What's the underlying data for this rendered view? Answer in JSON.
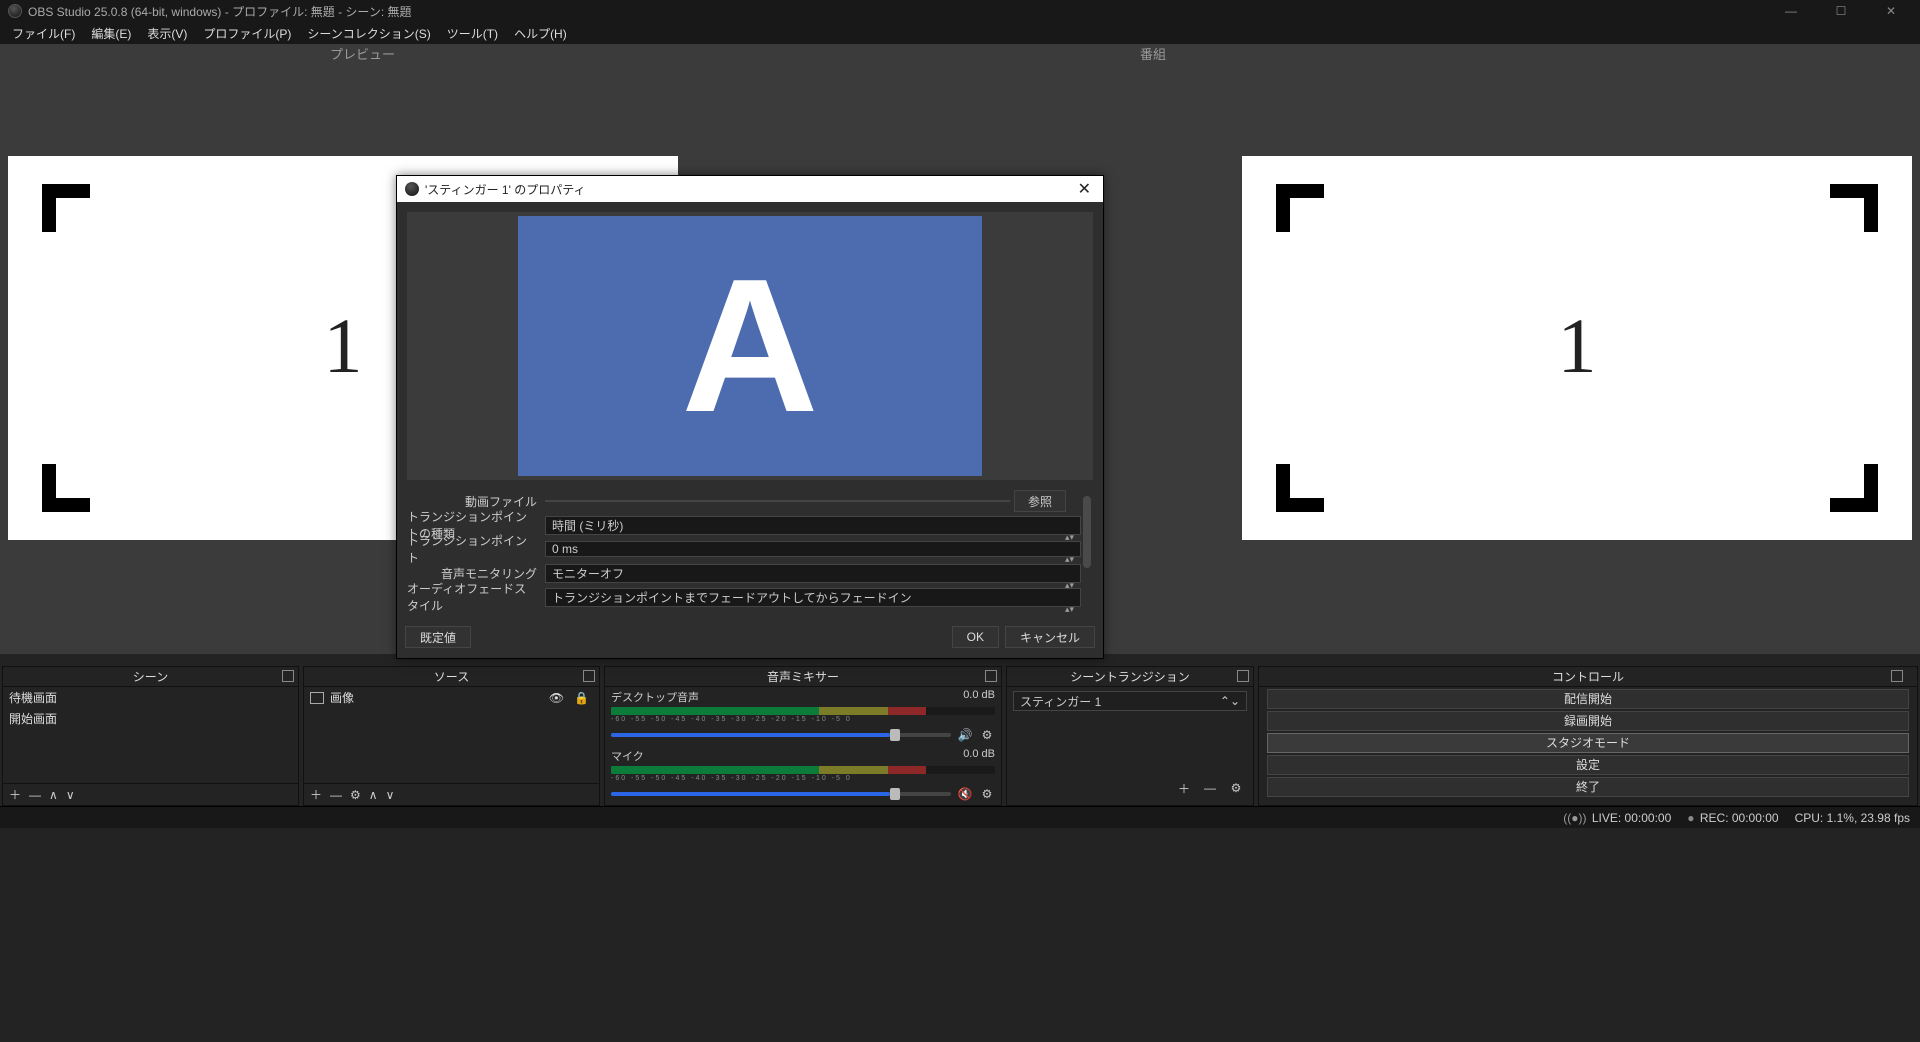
{
  "titlebar": {
    "text": "OBS Studio 25.0.8 (64-bit, windows) - プロファイル: 無題 - シーン: 無題"
  },
  "menubar": {
    "items": [
      "ファイル(F)",
      "編集(E)",
      "表示(V)",
      "プロファイル(P)",
      "シーンコレクション(S)",
      "ツール(T)",
      "ヘルプ(H)"
    ]
  },
  "labels": {
    "preview": "プレビュー",
    "program": "番組"
  },
  "canvas": {
    "number": "1"
  },
  "docks": {
    "scenes": {
      "title": "シーン",
      "items": [
        "待機画面",
        "開始画面"
      ]
    },
    "sources": {
      "title": "ソース",
      "items": [
        {
          "label": "画像"
        }
      ]
    },
    "mixer": {
      "title": "音声ミキサー",
      "channels": [
        {
          "name": "デスクトップ音声",
          "level": "0.0 dB",
          "muted": false
        },
        {
          "name": "マイク",
          "level": "0.0 dB",
          "muted": true
        }
      ],
      "ticks": "-60  -55  -50  -45  -40  -35  -30  -25  -20  -15  -10  -5  0"
    },
    "transitions": {
      "title": "シーントランジション",
      "selected": "スティンガー 1"
    },
    "controls": {
      "title": "コントロール",
      "buttons": [
        "配信開始",
        "録画開始",
        "スタジオモード",
        "設定",
        "終了"
      ],
      "active_index": 2
    }
  },
  "statusbar": {
    "live_label": "LIVE:",
    "live_time": "00:00:00",
    "rec_label": "REC:",
    "rec_time": "00:00:00",
    "cpu": "CPU: 1.1%, 23.98 fps"
  },
  "dialog": {
    "title": "'スティンガー 1' のプロパティ",
    "preview_letter": "A",
    "fields": {
      "video_file_label": "動画ファイル",
      "video_file_value": "",
      "browse": "参照",
      "tp_type_label": "トランジションポイントの種類",
      "tp_type_value": "時間 (ミリ秒)",
      "tp_label": "トランジションポイント",
      "tp_value": "0 ms",
      "monitor_label": "音声モニタリング",
      "monitor_value": "モニターオフ",
      "fade_label": "オーディオフェードスタイル",
      "fade_value": "トランジションポイントまでフェードアウトしてからフェードイン"
    },
    "buttons": {
      "defaults": "既定値",
      "ok": "OK",
      "cancel": "キャンセル"
    }
  }
}
